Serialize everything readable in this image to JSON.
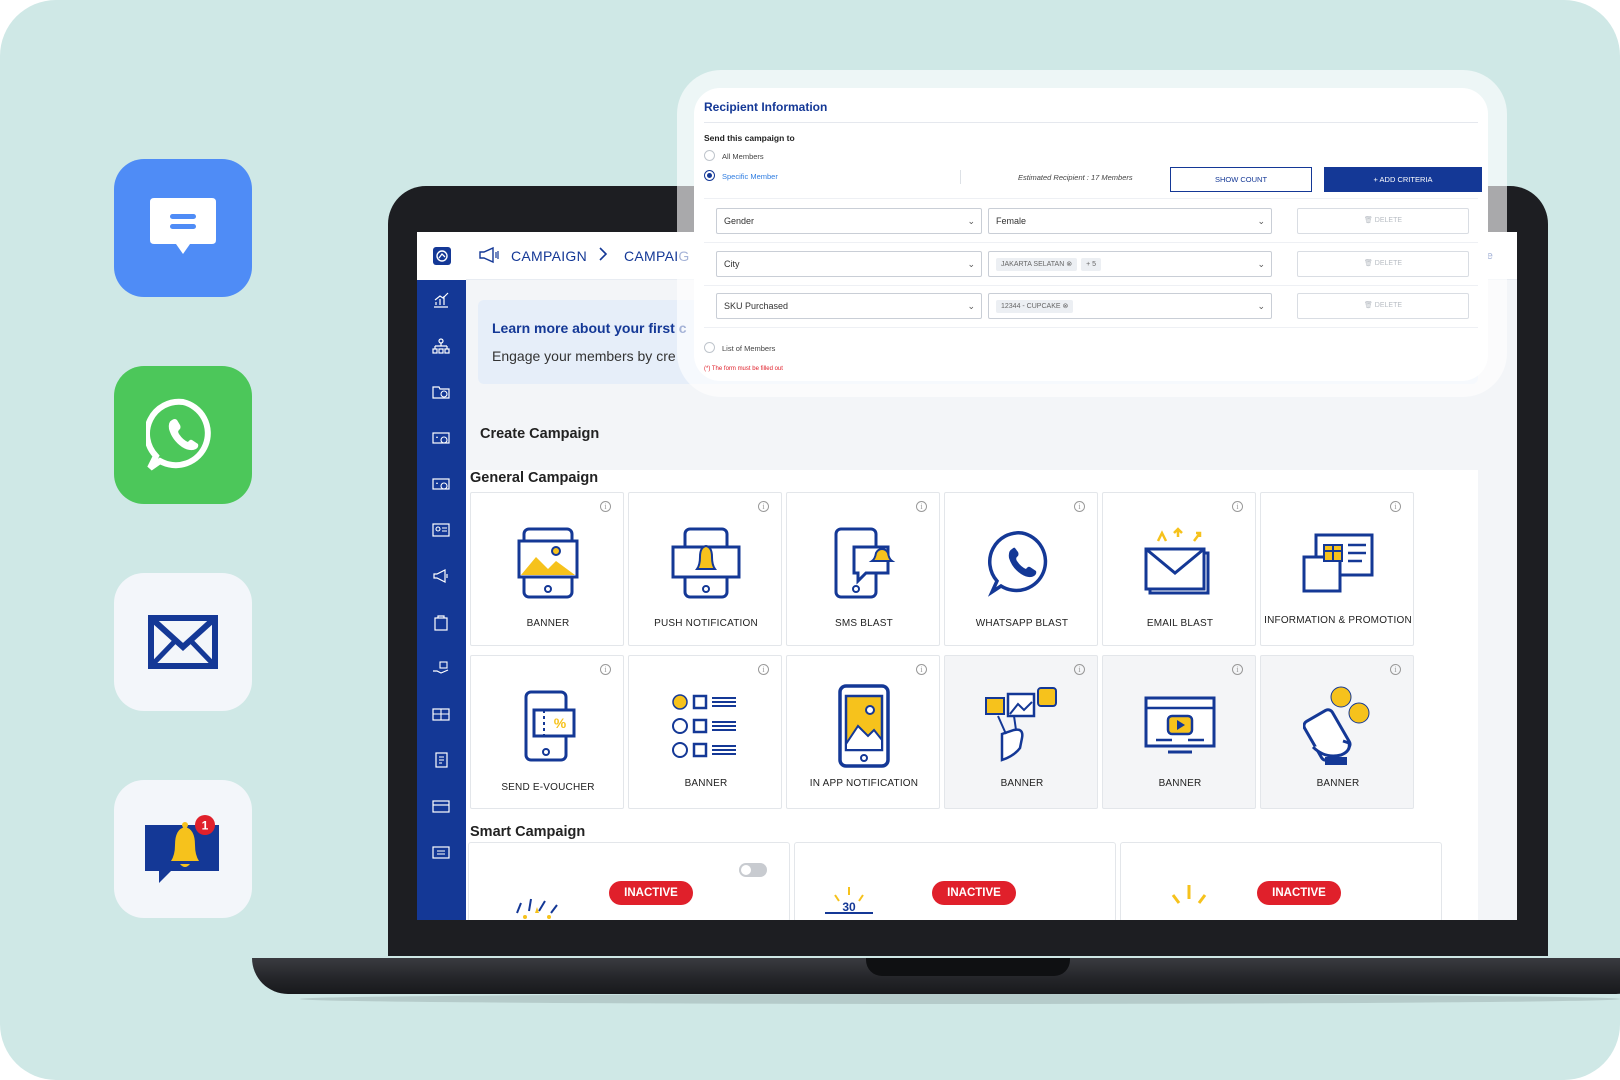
{
  "channels": [
    {
      "name": "chat",
      "icon": "chat-bubble-icon"
    },
    {
      "name": "whatsapp",
      "icon": "whatsapp-icon"
    },
    {
      "name": "email",
      "icon": "envelope-icon"
    },
    {
      "name": "notification",
      "icon": "bell-notification-icon",
      "badge": "1"
    }
  ],
  "breadcrumb": {
    "item1": "CAMPAIGN",
    "item2": "CAMPAIG",
    "right_text": "le"
  },
  "banner": {
    "title": "Learn more about your first c",
    "subtitle": "Engage your members by cre"
  },
  "headings": {
    "create": "Create Campaign",
    "general": "General Campaign",
    "smart": "Smart Campaign"
  },
  "cards": [
    {
      "label": "BANNER"
    },
    {
      "label": "PUSH NOTIFICATION"
    },
    {
      "label": "SMS BLAST"
    },
    {
      "label": "WHATSAPP BLAST"
    },
    {
      "label": "EMAIL BLAST"
    },
    {
      "label": "INFORMATION & PROMOTION"
    },
    {
      "label": "SEND E-VOUCHER"
    },
    {
      "label": "BANNER"
    },
    {
      "label": "IN APP NOTIFICATION"
    },
    {
      "label": "BANNER"
    },
    {
      "label": "BANNER"
    },
    {
      "label": "BANNER"
    }
  ],
  "info_glyph": "i",
  "smart_badge": "INACTIVE",
  "smart_30": "30",
  "panel": {
    "title": "Recipient Information",
    "send_to": "Send this campaign to",
    "opt_all": "All Members",
    "opt_specific": "Specific Member",
    "estimated": "Estimated Recipient : 17 Members",
    "show_count": "SHOW COUNT",
    "add_criteria": "+ ADD CRITERIA",
    "rows": [
      {
        "field": "Gender",
        "value": "Female",
        "chips": [],
        "delete": "DELETE"
      },
      {
        "field": "City",
        "value": "",
        "chips": [
          "JAKARTA SELATAN ⊗",
          "+ 5"
        ],
        "delete": "DELETE"
      },
      {
        "field": "SKU Purchased",
        "value": "",
        "chips": [
          "12344 - CUPCAKE ⊗"
        ],
        "delete": "DELETE"
      }
    ],
    "opt_list": "List of Members",
    "error": "(*) The form must be filled out"
  },
  "colors": {
    "brand": "#143896",
    "accent": "#f6c21c",
    "danger": "#e0202b",
    "background": "#cfe8e6"
  }
}
